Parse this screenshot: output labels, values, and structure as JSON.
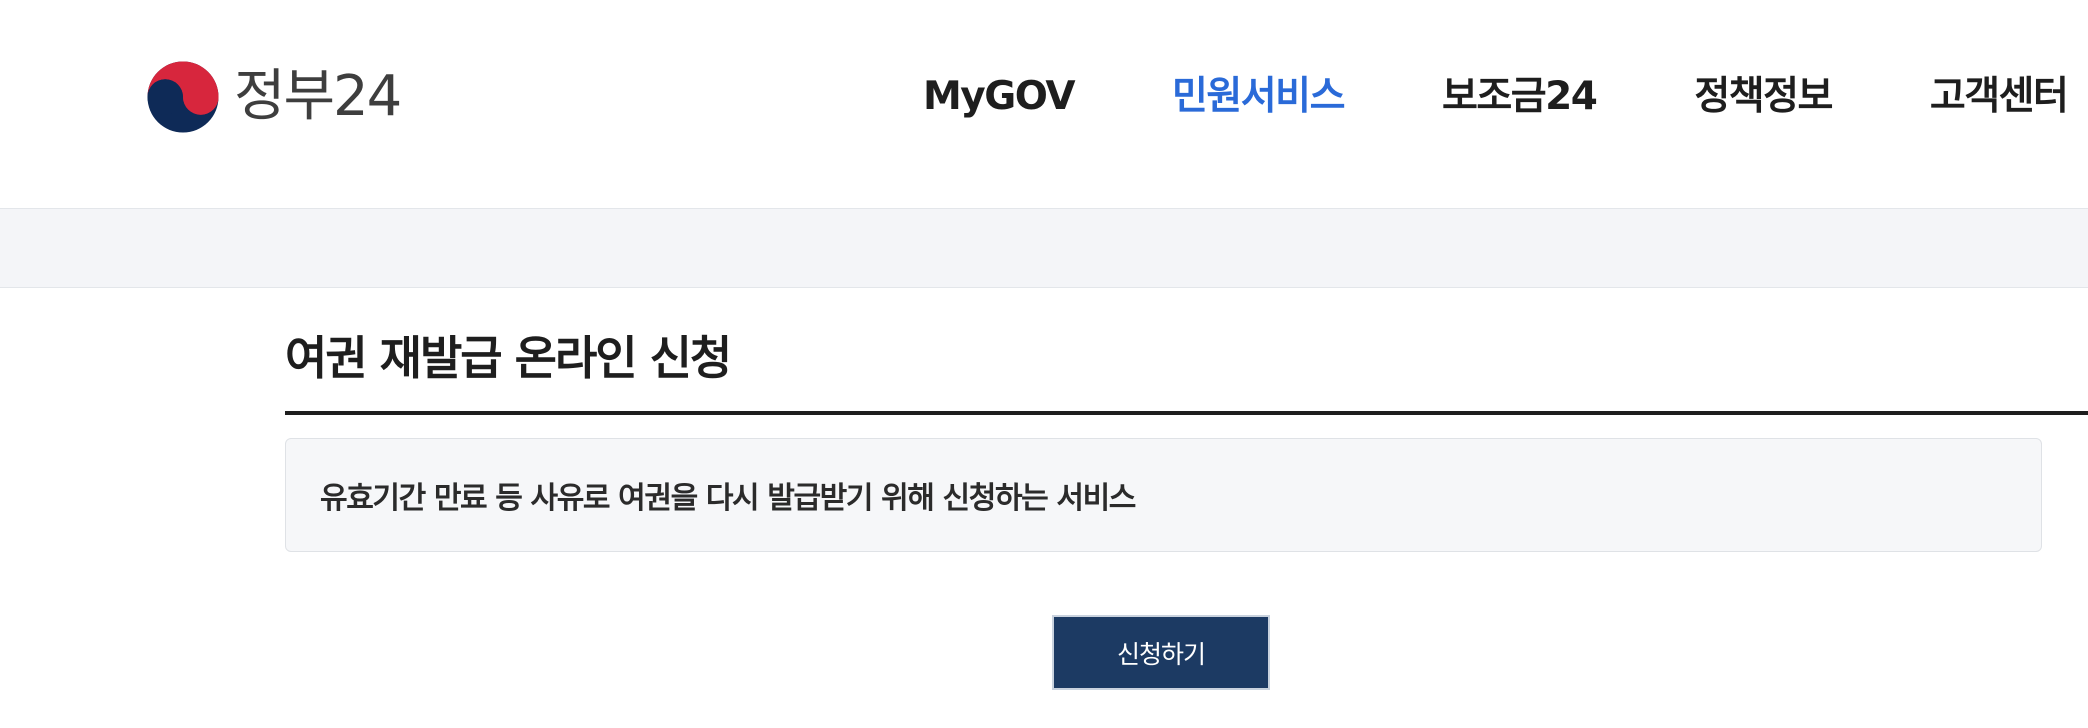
{
  "header": {
    "logo": {
      "text": "정부24",
      "icon": "taegeuk-emblem-icon"
    },
    "nav": [
      {
        "label": "MyGOV",
        "active": false
      },
      {
        "label": "민원서비스",
        "active": true
      },
      {
        "label": "보조금24",
        "active": false
      },
      {
        "label": "정책정보",
        "active": false
      },
      {
        "label": "고객센터",
        "active": false
      }
    ]
  },
  "main": {
    "title": "여권 재발급 온라인 신청",
    "description": "유효기간 만료 등 사유로 여권을 다시 발급받기 위해 신청하는 서비스",
    "apply_label": "신청하기"
  },
  "colors": {
    "accent": "#2a6ad8",
    "primary_button": "#1c3a63",
    "text": "#1e1e1e",
    "subbar": "#f4f5f8",
    "emblem_red": "#d7263d",
    "emblem_blue": "#0e2a57"
  }
}
